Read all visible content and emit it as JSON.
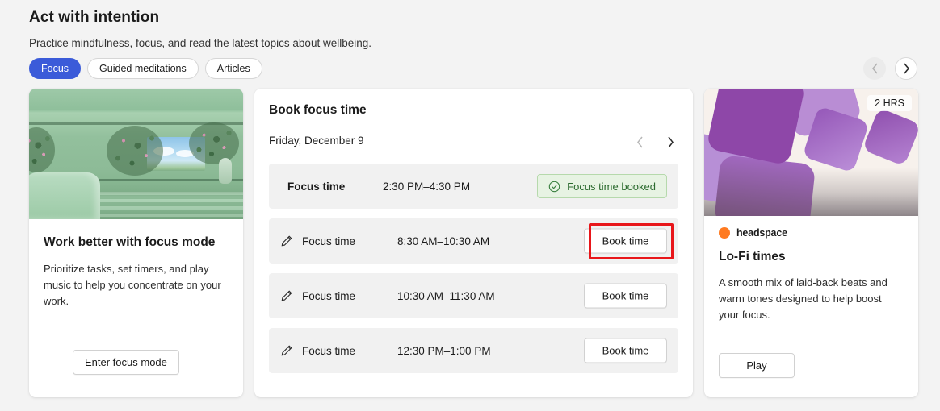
{
  "header": {
    "title": "Act with intention",
    "subtitle": "Practice mindfulness, focus, and read the latest topics about wellbeing.",
    "chips": [
      {
        "label": "Focus",
        "active": true
      },
      {
        "label": "Guided meditations",
        "active": false
      },
      {
        "label": "Articles",
        "active": false
      }
    ],
    "carousel": {
      "prev_icon": "chevron-left-icon",
      "next_icon": "chevron-right-icon",
      "prev_enabled": false,
      "next_enabled": true
    }
  },
  "focus_mode_card": {
    "image_alt": "green-interior-with-sky-window",
    "title": "Work better with focus mode",
    "description": "Prioritize tasks, set timers, and play music to help you concentrate on your work.",
    "button_label": "Enter focus mode"
  },
  "book_focus_card": {
    "title": "Book focus time",
    "date": "Friday, December 9",
    "prev_icon": "chevron-left-icon",
    "next_icon": "chevron-right-icon",
    "slots": [
      {
        "label": "Focus time",
        "time": "2:30 PM–4:30 PM",
        "state": "booked",
        "action_label": "Focus time booked",
        "icon": "check-circle-icon"
      },
      {
        "label": "Focus time",
        "time": "8:30 AM–10:30 AM",
        "state": "available",
        "action_label": "Book time",
        "icon": "pencil-icon",
        "highlighted": true
      },
      {
        "label": "Focus time",
        "time": "10:30 AM–11:30 AM",
        "state": "available",
        "action_label": "Book time",
        "icon": "pencil-icon"
      },
      {
        "label": "Focus time",
        "time": "12:30 PM–1:00 PM",
        "state": "available",
        "action_label": "Book time",
        "icon": "pencil-icon"
      }
    ]
  },
  "headspace_card": {
    "duration_badge": "2 HRS",
    "brand": "headspace",
    "title": "Lo-Fi times",
    "description": "A smooth mix of laid-back beats and warm tones designed to help boost your focus.",
    "button_label": "Play"
  },
  "colors": {
    "accent_blue": "#3b5bd9",
    "booked_green_text": "#2c6b2f",
    "booked_green_bg": "#e7f3e3",
    "highlight_red": "#e8161a",
    "headspace_orange": "#ff7a20",
    "page_bg": "#f3f3f3"
  }
}
